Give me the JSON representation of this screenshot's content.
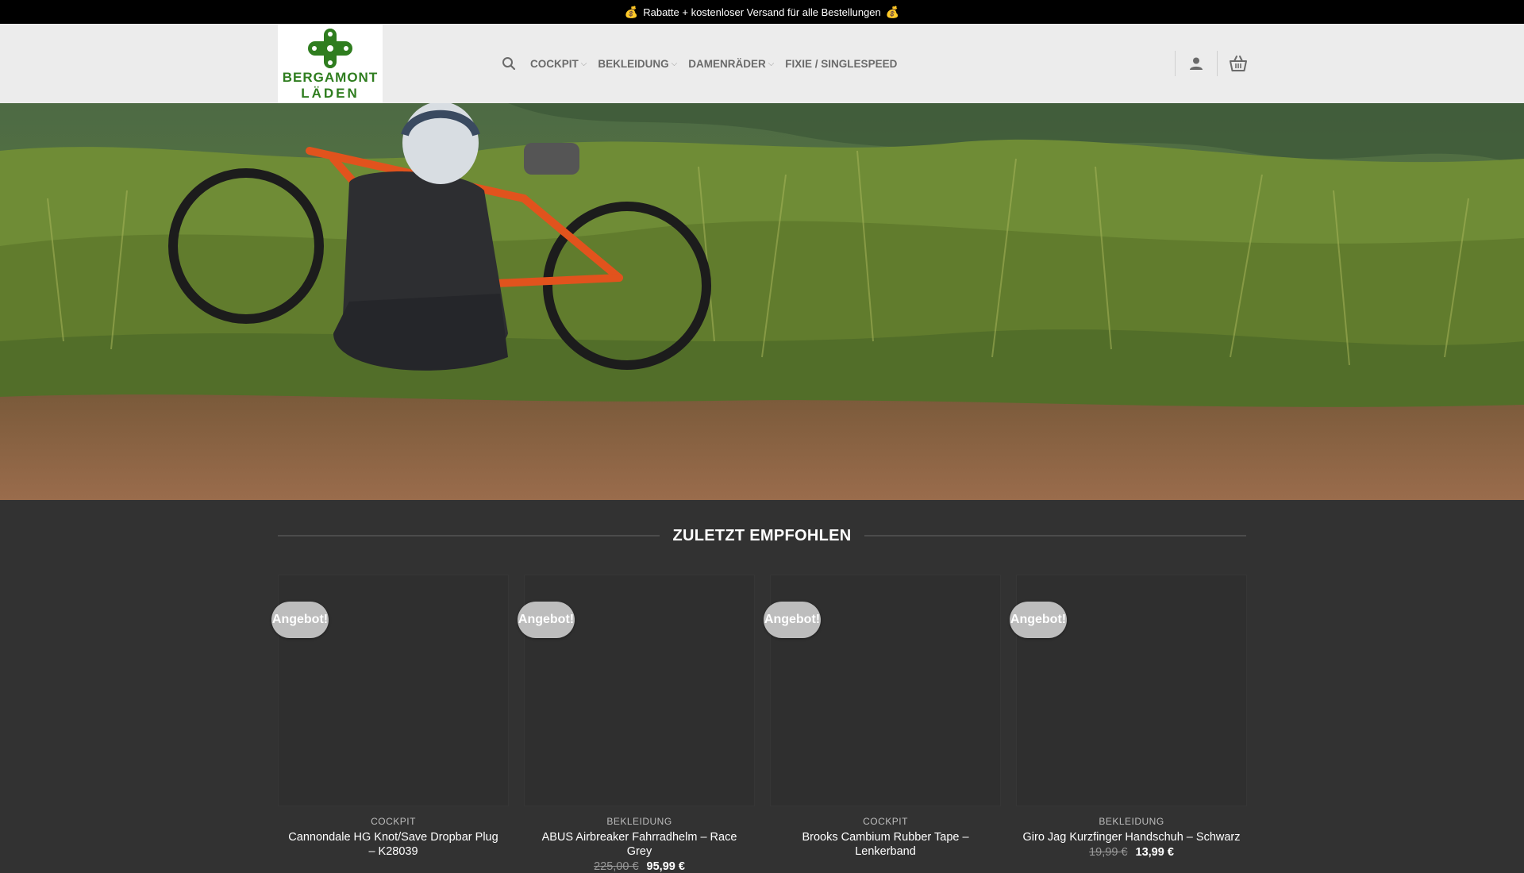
{
  "topbar": {
    "text": "Rabatte + kostenloser Versand für alle Bestellungen",
    "icon_left": "money-bag-icon",
    "icon_right": "money-bag-icon"
  },
  "logo": {
    "line1": "BERGAMONT",
    "line2": "LÄDEN",
    "color": "#2f7d1f"
  },
  "nav": {
    "items": [
      {
        "label": "COCKPIT",
        "has_dropdown": true
      },
      {
        "label": "BEKLEIDUNG",
        "has_dropdown": true
      },
      {
        "label": "DAMENRÄDER",
        "has_dropdown": true
      },
      {
        "label": "FIXIE / SINGLESPEED",
        "has_dropdown": false
      }
    ]
  },
  "section": {
    "title": "ZULETZT EMPFOHLEN"
  },
  "products": [
    {
      "badge": "Angebot!",
      "category": "COCKPIT",
      "name": "Cannondale HG Knot/Save Dropbar Plug – K28039",
      "old_price": "",
      "new_price": ""
    },
    {
      "badge": "Angebot!",
      "category": "BEKLEIDUNG",
      "name": "ABUS Airbreaker Fahrradhelm – Race Grey",
      "old_price": "225,00 €",
      "new_price": "95,99 €"
    },
    {
      "badge": "Angebot!",
      "category": "COCKPIT",
      "name": "Brooks Cambium Rubber Tape – Lenkerband",
      "old_price": "",
      "new_price": ""
    },
    {
      "badge": "Angebot!",
      "category": "BEKLEIDUNG",
      "name": "Giro Jag Kurzfinger Handschuh – Schwarz",
      "old_price": "19,99 €",
      "new_price": "13,99 €"
    }
  ],
  "colors": {
    "topbar_bg": "#000000",
    "header_bg": "#ececec",
    "page_bg": "#323232",
    "badge_bg": "#bdbdbd"
  }
}
